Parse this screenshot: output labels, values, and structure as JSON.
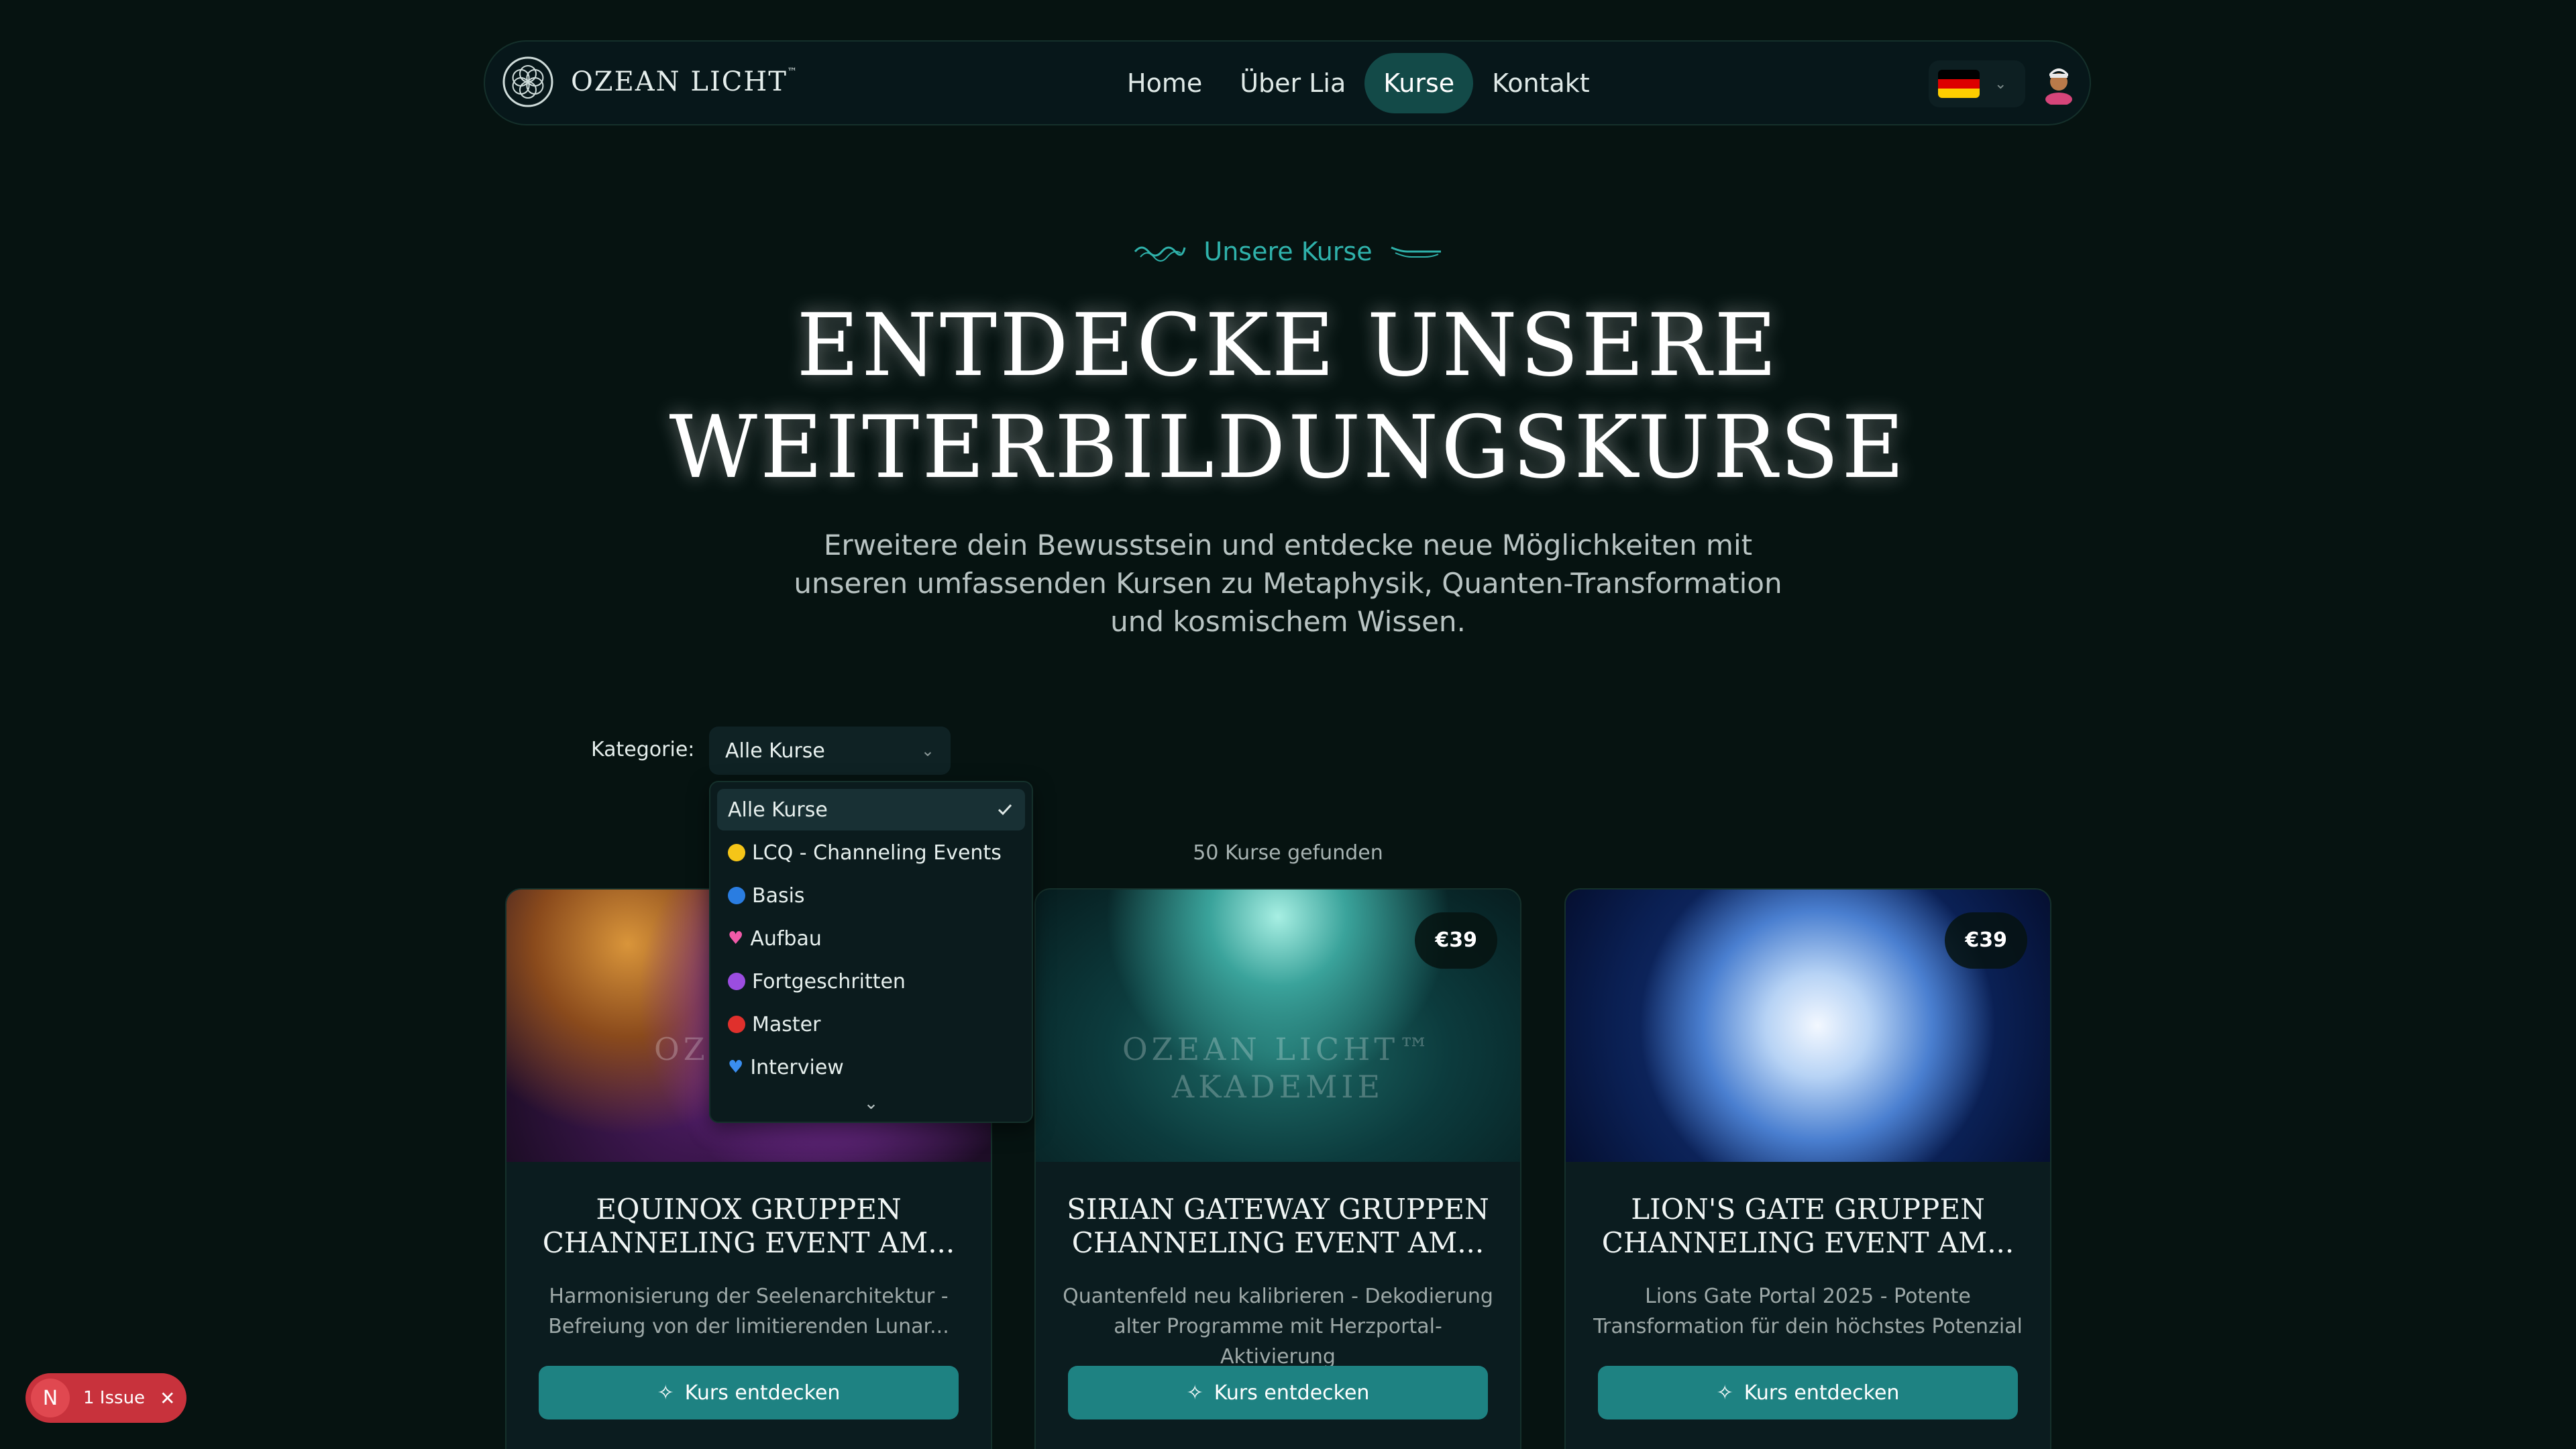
{
  "nav": {
    "brand": "OZEAN LICHT",
    "brand_tm": "™",
    "items": [
      "Home",
      "Über Lia",
      "Kurse",
      "Kontakt"
    ],
    "active": "Kurse"
  },
  "hero": {
    "eyebrow": "Unsere Kurse",
    "title_line1": "Entdecke unsere",
    "title_line2": "Weiterbildungskurse",
    "subtitle": "Erweitere dein Bewusstsein und entdecke neue Möglichkeiten mit unseren umfassenden Kursen zu Metaphysik, Quanten-Transformation und kosmischem Wissen."
  },
  "filter": {
    "label": "Kategorie:",
    "selected": "Alle Kurse",
    "options": [
      {
        "label": "Alle Kurse",
        "icon": "check-icon"
      },
      {
        "label": "LCQ - Channeling Events",
        "icon": "yellow-circle-icon",
        "color": "#f5c518"
      },
      {
        "label": "Basis",
        "icon": "blue-circle-icon",
        "color": "#2a7de1"
      },
      {
        "label": "Aufbau",
        "icon": "pink-heart-icon",
        "color": "#f05aa8"
      },
      {
        "label": "Fortgeschritten",
        "icon": "purple-circle-icon",
        "color": "#9b4de0"
      },
      {
        "label": "Master",
        "icon": "red-circle-icon",
        "color": "#e0302c"
      },
      {
        "label": "Interview",
        "icon": "blue-heart-icon",
        "color": "#3a8ef0"
      }
    ],
    "more_icon": "chevron-down-icon"
  },
  "results_count": "50 Kurse gefunden",
  "courses": [
    {
      "title": "Equinox Gruppen Channeling Event am...",
      "description": "Harmonisierung der Seelenarchitektur - Befreiung von der limitierenden Lunar...",
      "price": "",
      "button": "Kurs entdecken",
      "watermark": "OZE"
    },
    {
      "title": "Sirian Gateway Gruppen Channeling Event am...",
      "description": "Quantenfeld neu kalibrieren - Dekodierung alter Programme mit Herzportal-Aktivierung",
      "price": "€39",
      "button": "Kurs entdecken",
      "watermark": "OZEAN LICHT™ AKADEMIE"
    },
    {
      "title": "Lion's Gate Gruppen Channeling Event am...",
      "description": "Lions Gate Portal 2025 - Potente Transformation für dein höchstes Potenzial",
      "price": "€39",
      "button": "Kurs entdecken",
      "watermark": ""
    }
  ],
  "issue_badge": {
    "letter": "N",
    "text": "1 Issue",
    "close": "✕"
  },
  "colors": {
    "background": "#061311",
    "accent": "#2fb2ab",
    "button": "#1e8282",
    "issue": "#c8323c"
  }
}
